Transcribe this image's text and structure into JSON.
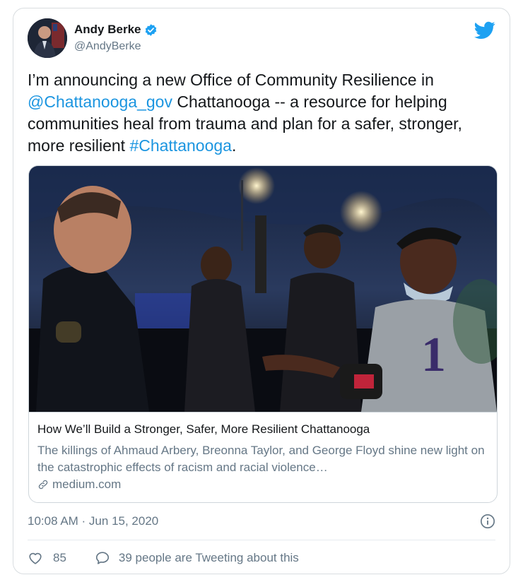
{
  "author": {
    "name": "Andy Berke",
    "handle": "@AndyBerke",
    "verified": true
  },
  "tweet": {
    "text_before_mention": "I’m announcing a new Office of Community Resilience in ",
    "mention": "@Chattanooga_gov",
    "text_middle": " Chattanooga -- a resource for helping communities heal from trauma and plan for a safer, stronger, more resilient ",
    "hashtag": "#Chattanooga",
    "text_end": "."
  },
  "link_card": {
    "title": "How We’ll Build a Stronger, Safer, More Resilient Chattanooga",
    "description": "The killings of Ahmaud Arbery, Breonna Taylor, and George Floyd shine new light on the catastrophic effects of racism and racial violence…",
    "domain": "medium.com"
  },
  "meta": {
    "timestamp": "10:08 AM · Jun 15, 2020"
  },
  "actions": {
    "like_count": "85",
    "reply_text": "39 people are Tweeting about this"
  },
  "colors": {
    "link": "#1b95e0",
    "twitter_blue": "#1da1f2",
    "secondary_text": "#657786",
    "border": "#d9dde0"
  },
  "icons": [
    "verified-badge-icon",
    "twitter-bird-icon",
    "link-chain-icon",
    "info-icon",
    "heart-icon",
    "speech-bubble-icon"
  ]
}
